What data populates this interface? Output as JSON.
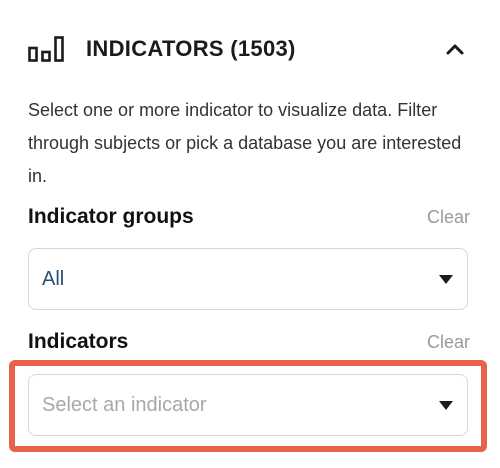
{
  "header": {
    "icon": "bar-chart-icon",
    "title": "INDICATORS (1503)",
    "collapse_icon": "chevron-up-icon"
  },
  "description": "Select one or more indicator to visualize data. Filter through subjects or pick a database you are interested in.",
  "indicator_groups": {
    "label": "Indicator groups",
    "clear_label": "Clear",
    "selected_value": "All",
    "caret_icon": "caret-down-icon"
  },
  "indicators": {
    "label": "Indicators",
    "clear_label": "Clear",
    "placeholder": "Select an indicator",
    "caret_icon": "caret-down-icon"
  },
  "colors": {
    "highlight": "#e8614a",
    "selected_text": "#264f75",
    "placeholder_text": "#a8a8a8",
    "clear_text": "#9a9a9a"
  }
}
